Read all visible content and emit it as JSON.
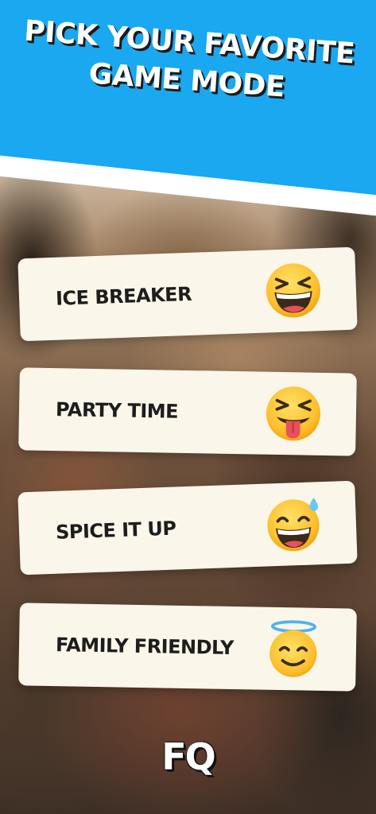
{
  "header": {
    "title_line1": "PICK YOUR FAVORITE",
    "title_line2": "GAME MODE"
  },
  "modes": [
    {
      "label": "ICE BREAKER",
      "icon": "grinning-squinting-face-icon"
    },
    {
      "label": "PARTY TIME",
      "icon": "squinting-face-with-tongue-icon"
    },
    {
      "label": "SPICE IT UP",
      "icon": "grinning-face-with-sweat-icon"
    },
    {
      "label": "FAMILY FRIENDLY",
      "icon": "smiling-face-with-halo-icon"
    }
  ],
  "logo": "FQ",
  "colors": {
    "header_blue": "#1aa8f0",
    "card_bg": "#fbf6ea",
    "text_dark": "#1d1d1d",
    "emoji_yellow": "#fbc02d"
  }
}
